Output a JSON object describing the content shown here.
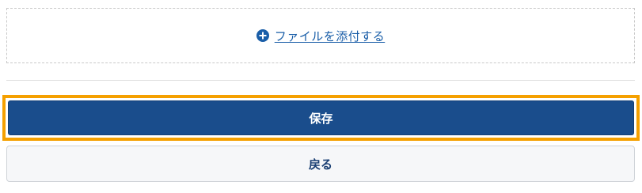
{
  "attachment": {
    "link_label": "ファイルを添付する",
    "icon": "plus-circle-icon",
    "link_color": "#1a5ea8"
  },
  "actions": {
    "save_label": "保存",
    "back_label": "戻る"
  },
  "colors": {
    "primary": "#1a4d8c",
    "focus_ring": "#f5a000",
    "secondary_bg": "#f6f7f9"
  }
}
